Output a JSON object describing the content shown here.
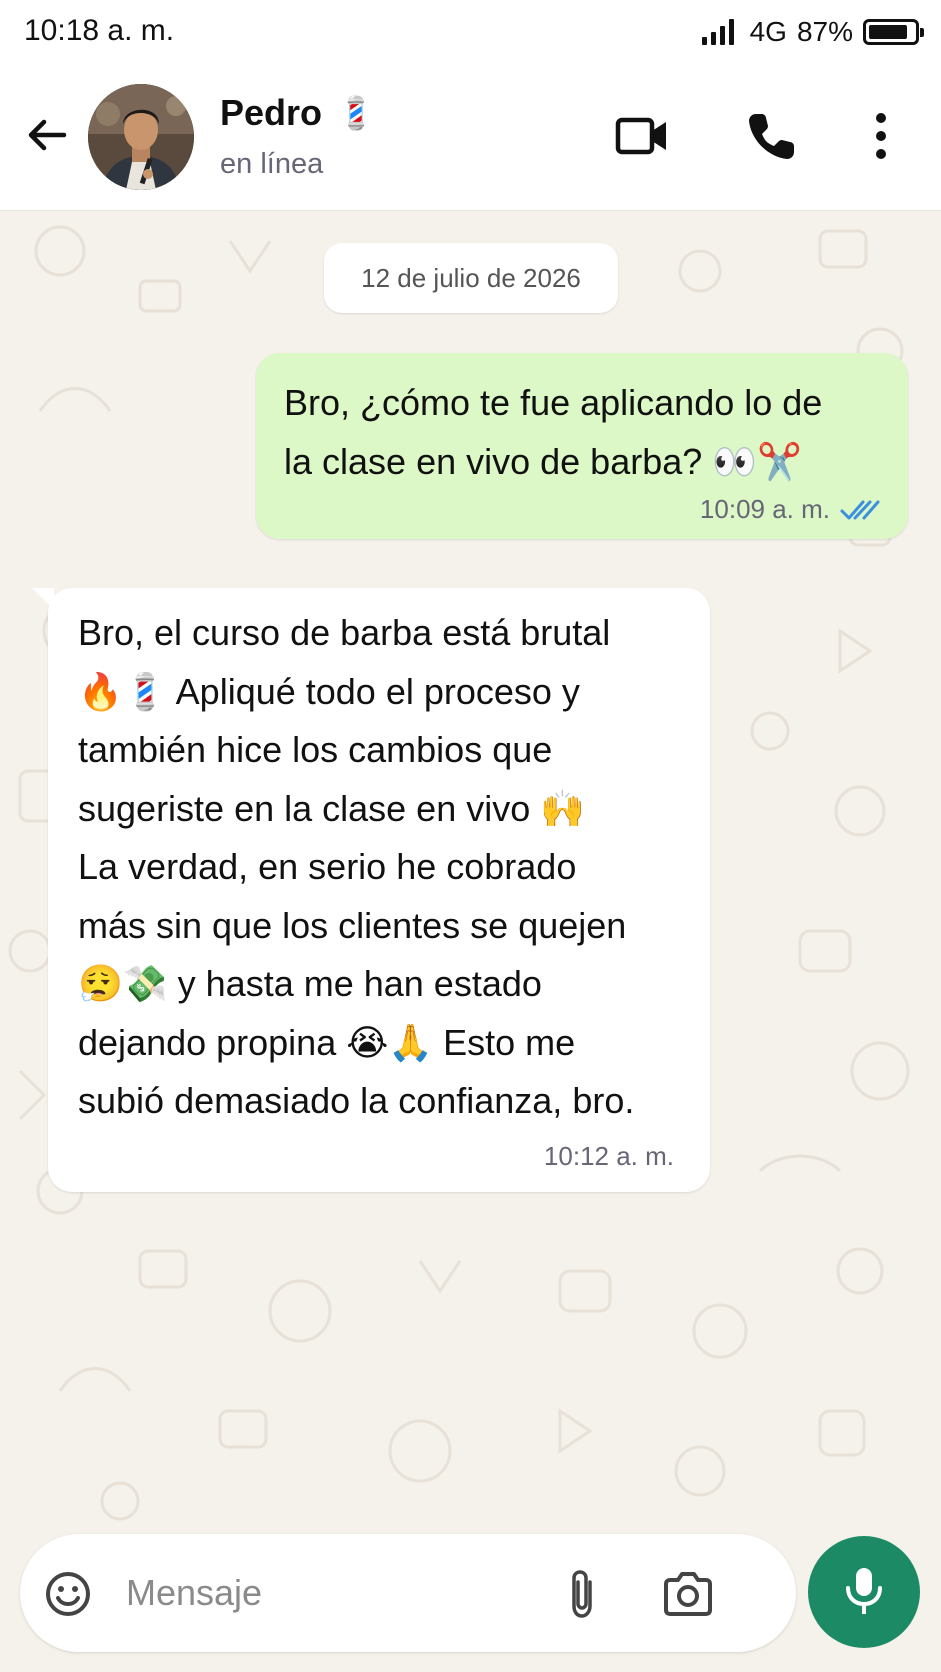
{
  "status_bar": {
    "time": "10:18 a. m.",
    "network": "4G",
    "battery": "87%",
    "battery_level": 0.87,
    "icons": [
      "signal-bars-icon",
      "battery-icon"
    ]
  },
  "header": {
    "contact_name": "Pedro",
    "name_emoji": "💈",
    "status": "en línea",
    "icons": [
      "back-arrow-icon",
      "video-call-icon",
      "phone-icon",
      "more-options-icon"
    ]
  },
  "chat": {
    "date_chip": "12 de julio de 2026",
    "messages": [
      {
        "direction": "outgoing",
        "text": "Bro, ¿cómo te fue aplicando lo de\nla clase en vivo de barba? 👀✂️",
        "time": "10:09 a. m.",
        "status": "read"
      },
      {
        "direction": "incoming",
        "text": "Bro, el curso de barba está brutal\n🔥💈 Apliqué todo el proceso y\ntambién hice los cambios que\nsugeriste en la clase en vivo 🙌\nLa verdad, en serio he cobrado\nmás sin que los clientes se quejen\n😮‍💨💸 y hasta me han estado\ndejando propina 😭🙏 Esto me\nsubió demasiado la confianza, bro.",
        "time": "10:12 a. m."
      }
    ]
  },
  "composer": {
    "placeholder": "Mensaje",
    "icons": [
      "emoji-icon",
      "attach-icon",
      "camera-icon",
      "mic-icon"
    ]
  },
  "colors": {
    "outgoing_bubble": "#dcf8c6",
    "incoming_bubble": "#ffffff",
    "chat_background": "#f5f1eb",
    "mic_button": "#1d8a66",
    "read_ticks": "#3b8fe0"
  }
}
